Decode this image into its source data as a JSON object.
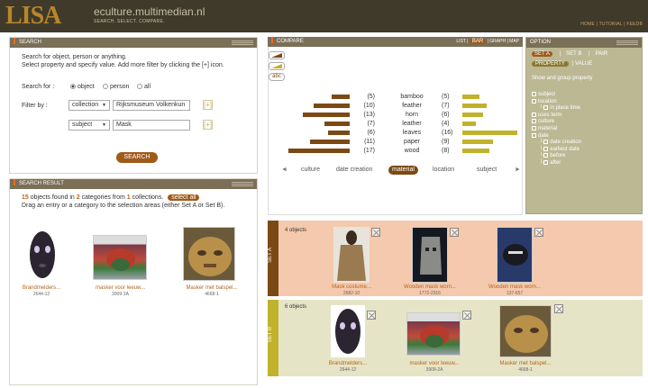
{
  "header": {
    "logo": "LISA",
    "site": "eculture.multimedian.nl",
    "tagline": "SEARCH. SELECT. COMPARE.",
    "nav": "HOME | TUTORIAL | FEEDB"
  },
  "search": {
    "title": "SEARCH",
    "intro1": "Search for object, person or anything.",
    "intro2": "Select property and specify value. Add more filter by clicking the [+] icon.",
    "search_for_label": "Search for :",
    "radios": [
      "object",
      "person",
      "all"
    ],
    "filter_label": "Filter by :",
    "filter1_property": "collection",
    "filter1_value": "Rijksmuseum Volkenkun",
    "filter2_property": "subject",
    "filter2_value": "Mask",
    "plus": "[+]",
    "button": "SEARCH"
  },
  "result": {
    "title": "SEARCH RESULT",
    "count": "15",
    "t1": " objects found in ",
    "cats": "2",
    "t2": " categories from ",
    "colls": "1",
    "t3": " collections.",
    "select_all": "select all",
    "hint": "Drag an entry or a category to the selection areas (either Set A or Set B).",
    "items": [
      {
        "title": "Brandmelders...",
        "id": "2644-12"
      },
      {
        "title": "masker voor leeuw...",
        "id": "3909-2A"
      },
      {
        "title": "Masker met balspel...",
        "id": "4668-1"
      }
    ]
  },
  "compare": {
    "title": "COMPARE",
    "views": [
      "LIST",
      "BAR",
      "GRAPH",
      "MAP"
    ],
    "active_view": "BAR",
    "abc": "abc",
    "properties": [
      "culture",
      "date creation",
      "material",
      "location",
      "subject"
    ],
    "active_property": "material",
    "left_arrow": "◄",
    "right_arrow": "►"
  },
  "chart_data": {
    "type": "bar",
    "categories": [
      "bamboo",
      "feather",
      "horn",
      "leather",
      "leaves",
      "paper",
      "wood"
    ],
    "series": [
      {
        "name": "SET A",
        "values": [
          5,
          10,
          13,
          7,
          6,
          11,
          17
        ],
        "color": "#7b4a14"
      },
      {
        "name": "SET B",
        "values": [
          5,
          7,
          6,
          4,
          16,
          9,
          8
        ],
        "color": "#c0b22c"
      }
    ],
    "left_labels": [
      "(5)",
      "(10)",
      "(13)",
      "(7)",
      "(6)",
      "(11)",
      "(17)"
    ],
    "right_labels": [
      "(5)",
      "(7)",
      "(6)",
      "(4)",
      "(16)",
      "(9)",
      "(8)"
    ]
  },
  "option": {
    "title": "OPTION",
    "tabs": [
      "SET A",
      "SET B",
      "PAIR"
    ],
    "subtabs": [
      "PROPERTY",
      "VALUE"
    ],
    "desc": "Show and group property",
    "tree": [
      {
        "label": "subject",
        "level": 0
      },
      {
        "label": "location",
        "level": 0
      },
      {
        "label": "in place time",
        "level": 1
      },
      {
        "label": "uses term",
        "level": 0
      },
      {
        "label": "culture",
        "level": 0
      },
      {
        "label": "material",
        "level": 0
      },
      {
        "label": "date",
        "level": 0
      },
      {
        "label": "date creation",
        "level": 1
      },
      {
        "label": "earliest date",
        "level": 1
      },
      {
        "label": "before",
        "level": 1
      },
      {
        "label": "after",
        "level": 1
      }
    ]
  },
  "setA": {
    "label": "SET A",
    "count": "4 objects",
    "items": [
      {
        "title": "Mask costume...",
        "id": "2682-10"
      },
      {
        "title": "Wooden mask worn...",
        "id": "1772-2316"
      },
      {
        "title": "Wooden mask worn...",
        "id": "137-657"
      }
    ]
  },
  "setB": {
    "label": "SET B",
    "count": "6 objects",
    "items": [
      {
        "title": "Brandmelders...",
        "id": "2644-12"
      },
      {
        "title": "masker voor leeuw...",
        "id": "3909-2A"
      },
      {
        "title": "Masker met balspel...",
        "id": "4668-1"
      }
    ]
  },
  "colors": {
    "accent": "#b5651d",
    "brown": "#7b4a14",
    "olive": "#c0b22c",
    "header": "#3f3a2a"
  }
}
